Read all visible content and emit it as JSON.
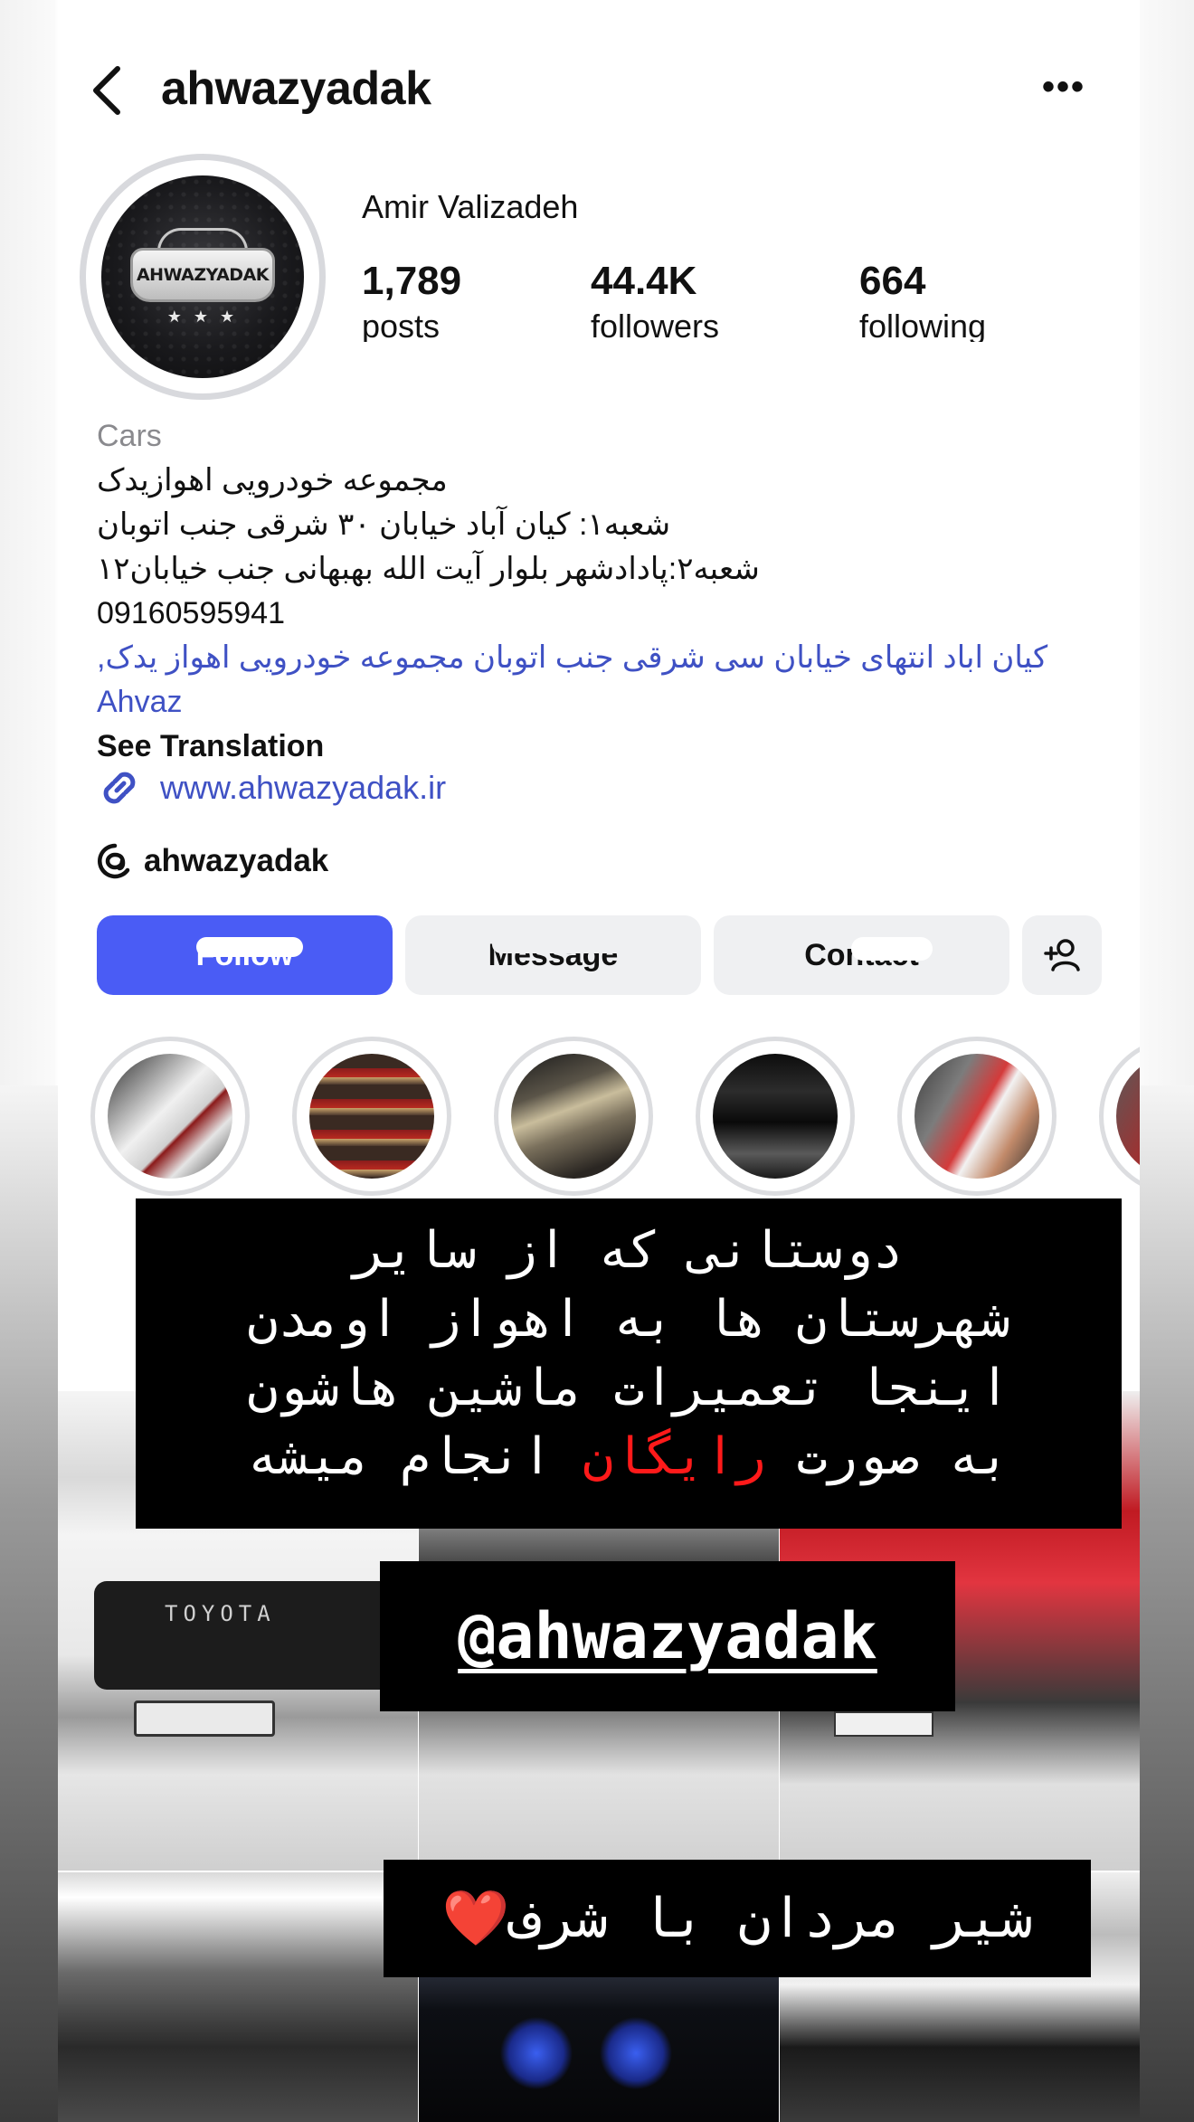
{
  "header": {
    "username": "ahwazyadak",
    "more_glyph": "•••"
  },
  "avatar": {
    "logo_text": "AHWAZYADAK",
    "stars": "★ ★ ★"
  },
  "profile": {
    "display_name": "Amir Valizadeh",
    "stats": [
      {
        "value": "1,789",
        "label": "posts"
      },
      {
        "value": "44.4K",
        "label": "followers"
      },
      {
        "value": "664",
        "label": "following"
      }
    ]
  },
  "bio": {
    "category": "Cars",
    "line1": "مجموعه خودرویی اهوازیدک",
    "line2": "شعبه۱: کیان آباد خیابان ۳۰ شرقی جنب اتوبان",
    "line3": "شعبه۲:پادادشهر بلوار آیت الله بهبهانی جنب خیابان۱۲",
    "phone": "09160595941",
    "location_line1": "کیان اباد انتهای خیابان سی شرقی جنب اتوبان مجموعه خودرویی اهواز یدک,",
    "location_line2": "Ahvaz",
    "see_translation": "See Translation",
    "website": "www.ahwazyadak.ir",
    "threads_handle": "ahwazyadak"
  },
  "buttons": {
    "follow": "Follow",
    "message": "Message",
    "contact": "Contact"
  },
  "overlay": {
    "line1": "دوستانی که از سایر",
    "line2": "شهرستان ها به اهواز اومدن",
    "line3": "اینجا تعمیرات ماشین هاشون",
    "line4_pre": "به صورت ",
    "line4_red": "رایگان",
    "line4_post": " انجام میشه",
    "handle": "@ahwazyadak",
    "closing": "شیر مردان با شرف❤️",
    "red_color": "#ff1a1a"
  },
  "grid_texts": {
    "toyota": "TOYOTA"
  },
  "colors": {
    "accent": "#4a5cf5",
    "link": "#3f51c4"
  }
}
